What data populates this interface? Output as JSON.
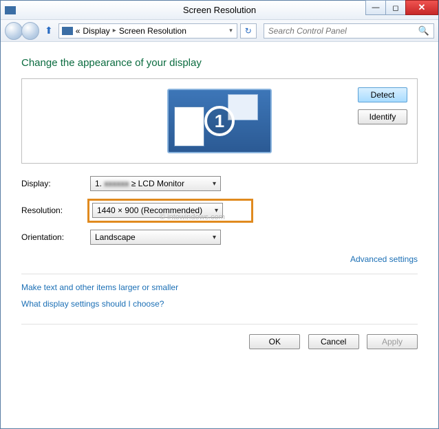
{
  "window": {
    "title": "Screen Resolution"
  },
  "breadcrumb": {
    "root": "«",
    "item1": "Display",
    "item2": "Screen Resolution"
  },
  "search": {
    "placeholder": "Search Control Panel"
  },
  "heading": "Change the appearance of your display",
  "buttons": {
    "detect": "Detect",
    "identify": "Identify",
    "ok": "OK",
    "cancel": "Cancel",
    "apply": "Apply"
  },
  "monitor_number": "1",
  "fields": {
    "display_label": "Display:",
    "display_value_prefix": "1.",
    "display_value_blur": "xxxxxx",
    "display_value_suffix": "≥ LCD Monitor",
    "resolution_label": "Resolution:",
    "resolution_value": "1440 × 900 (Recommended)",
    "orientation_label": "Orientation:",
    "orientation_value": "Landscape"
  },
  "links": {
    "advanced": "Advanced settings",
    "larger": "Make text and other items larger or smaller",
    "choose": "What display settings should I choose?"
  },
  "watermark": "© intowindows.com"
}
